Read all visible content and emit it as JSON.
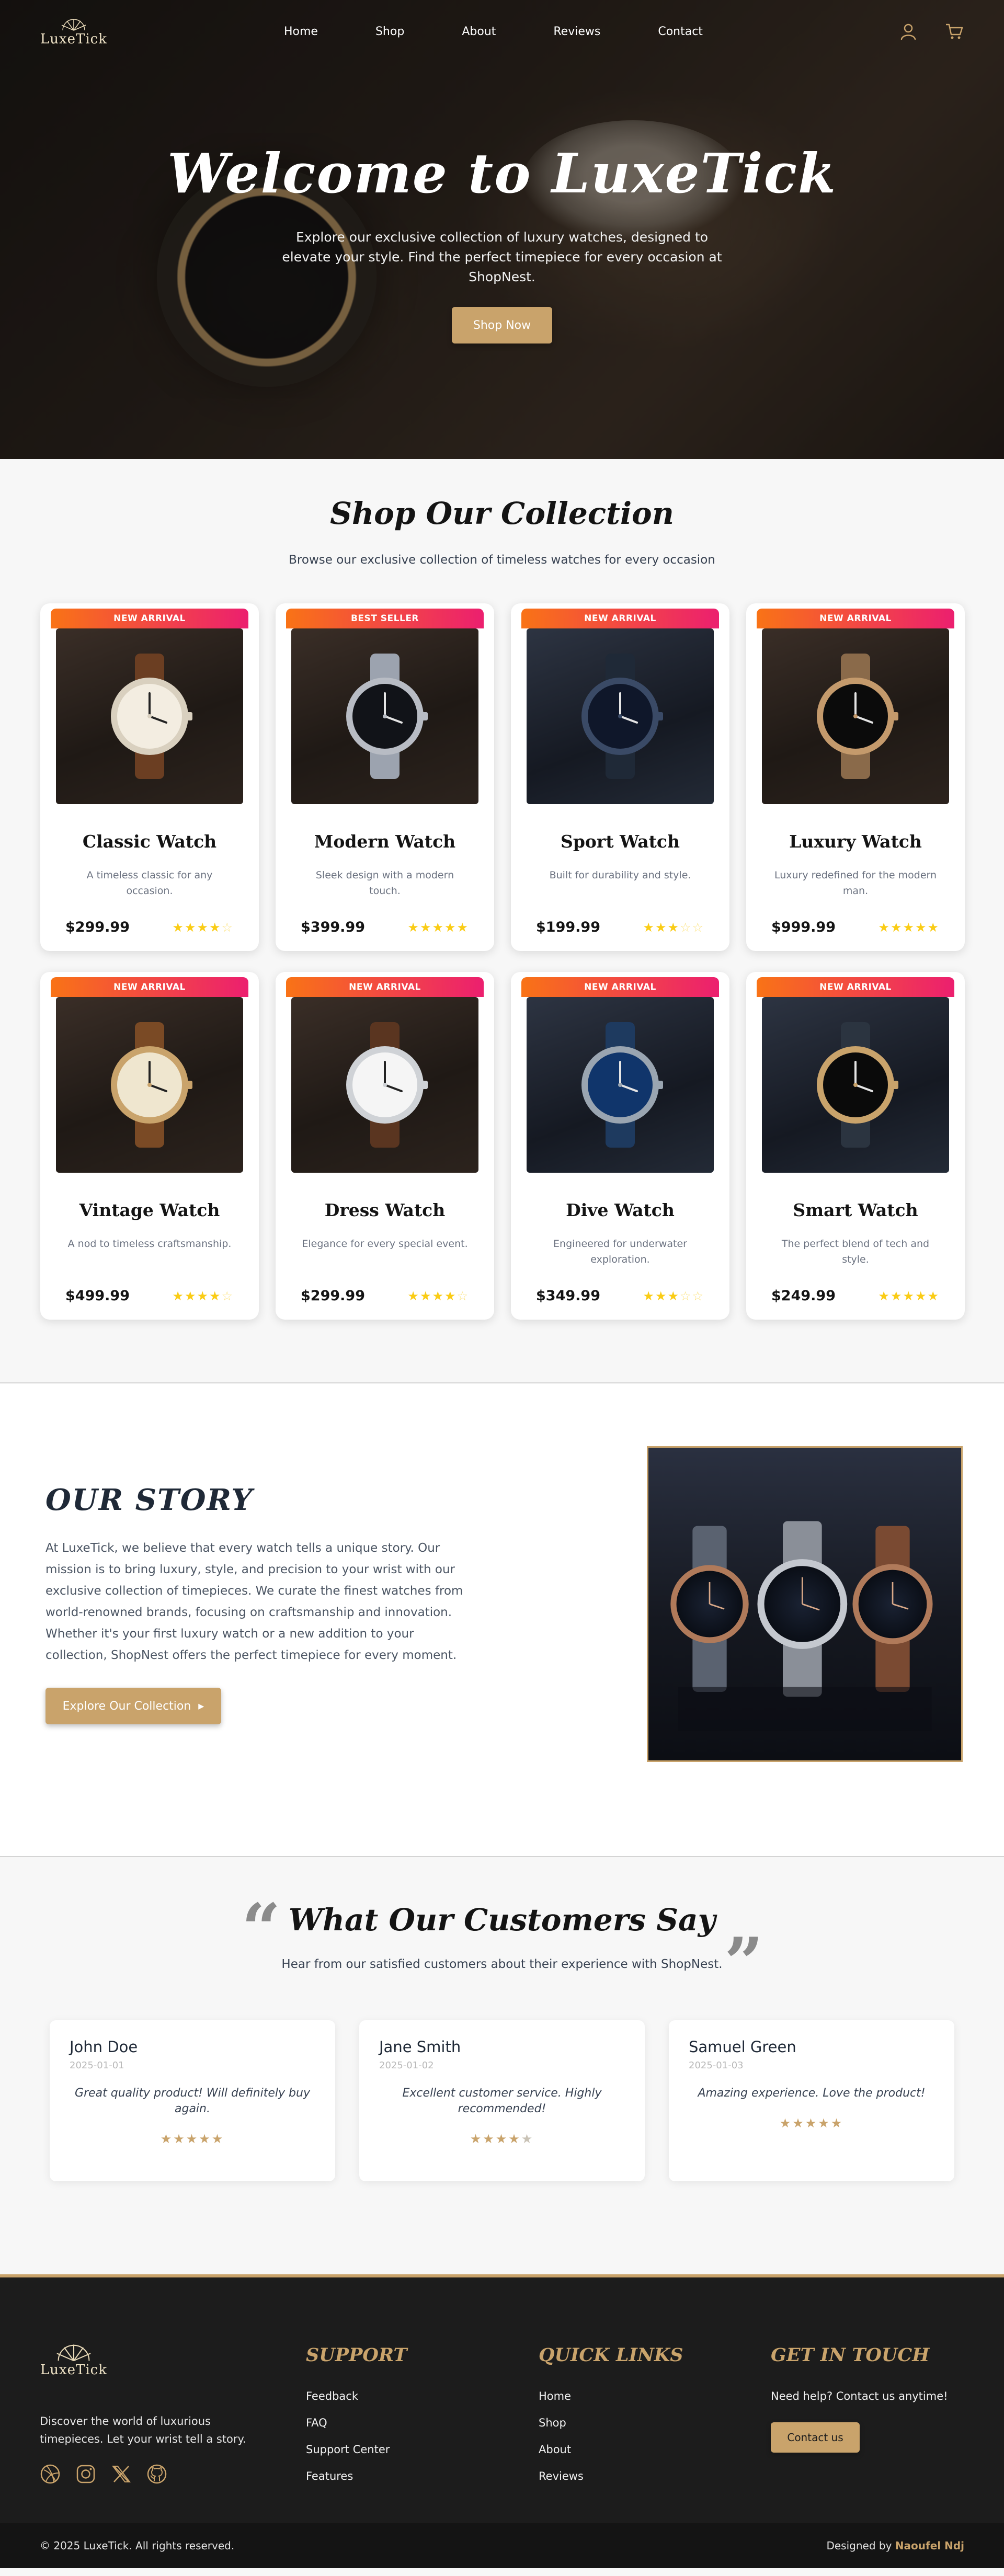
{
  "brand": {
    "name": "LuxeTick",
    "accent": "#c9a36b"
  },
  "nav": {
    "links": [
      "Home",
      "Shop",
      "About",
      "Reviews",
      "Contact"
    ],
    "icons": [
      "user-icon",
      "cart-icon"
    ]
  },
  "hero": {
    "title": "Welcome to LuxeTick",
    "subtitle": "Explore our exclusive collection of luxury watches, designed to elevate your style. Find the perfect timepiece for every occasion at ShopNest.",
    "button": "Shop Now"
  },
  "collection": {
    "title": "Shop Our Collection",
    "subtitle": "Browse our exclusive collection of timeless watches for every occasion",
    "products": [
      {
        "badge": "NEW ARRIVAL",
        "name": "Classic Watch",
        "desc": "A timeless classic for any occasion.",
        "price": "$299.99",
        "rating": 4
      },
      {
        "badge": "BEST SELLER",
        "name": "Modern Watch",
        "desc": "Sleek design with a modern touch.",
        "price": "$399.99",
        "rating": 5
      },
      {
        "badge": "NEW ARRIVAL",
        "name": "Sport Watch",
        "desc": "Built for durability and style.",
        "price": "$199.99",
        "rating": 3
      },
      {
        "badge": "NEW ARRIVAL",
        "name": "Luxury Watch",
        "desc": "Luxury redefined for the modern man.",
        "price": "$999.99",
        "rating": 5
      },
      {
        "badge": "NEW ARRIVAL",
        "name": "Vintage Watch",
        "desc": "A nod to timeless craftsmanship.",
        "price": "$499.99",
        "rating": 4
      },
      {
        "badge": "NEW ARRIVAL",
        "name": "Dress Watch",
        "desc": "Elegance for every special event.",
        "price": "$299.99",
        "rating": 4
      },
      {
        "badge": "NEW ARRIVAL",
        "name": "Dive Watch",
        "desc": "Engineered for underwater exploration.",
        "price": "$349.99",
        "rating": 3
      },
      {
        "badge": "NEW ARRIVAL",
        "name": "Smart Watch",
        "desc": "The perfect blend of tech and style.",
        "price": "$249.99",
        "rating": 5
      }
    ]
  },
  "story": {
    "title": "OUR STORY",
    "text": "At LuxeTick, we believe that every watch tells a unique story. Our mission is to bring luxury, style, and precision to your wrist with our exclusive collection of timepieces. We curate the finest watches from world-renowned brands, focusing on craftsmanship and innovation. Whether it's your first luxury watch or a new addition to your collection, ShopNest offers the perfect timepiece for every moment.",
    "button": "Explore Our Collection"
  },
  "reviews": {
    "title": "What Our Customers Say",
    "subtitle": "Hear from our satisfied customers about their experience with ShopNest.",
    "items": [
      {
        "name": "John Doe",
        "date": "2025-01-01",
        "text": "Great quality product! Will definitely buy again.",
        "rating": 5
      },
      {
        "name": "Jane Smith",
        "date": "2025-01-02",
        "text": "Excellent customer service. Highly recommended!",
        "rating": 4
      },
      {
        "name": "Samuel Green",
        "date": "2025-01-03",
        "text": "Amazing experience. Love the product!",
        "rating": 5
      }
    ]
  },
  "footer": {
    "tagline": "Discover the world of luxurious timepieces. Let your wrist tell a story.",
    "social": [
      "dribbble-icon",
      "instagram-icon",
      "x-icon",
      "github-icon"
    ],
    "support": {
      "title": "SUPPORT",
      "links": [
        "Feedback",
        "FAQ",
        "Support Center",
        "Features"
      ]
    },
    "quick": {
      "title": "QUICK LINKS",
      "links": [
        "Home",
        "Shop",
        "About",
        "Reviews"
      ]
    },
    "contact": {
      "title": "GET IN TOUCH",
      "text": "Need help? Contact us anytime!",
      "button": "Contact us"
    },
    "copyright": "© 2025 LuxeTick. All rights reserved.",
    "designed_by_label": "Designed by",
    "designed_by_name": "Naoufel Ndj"
  }
}
